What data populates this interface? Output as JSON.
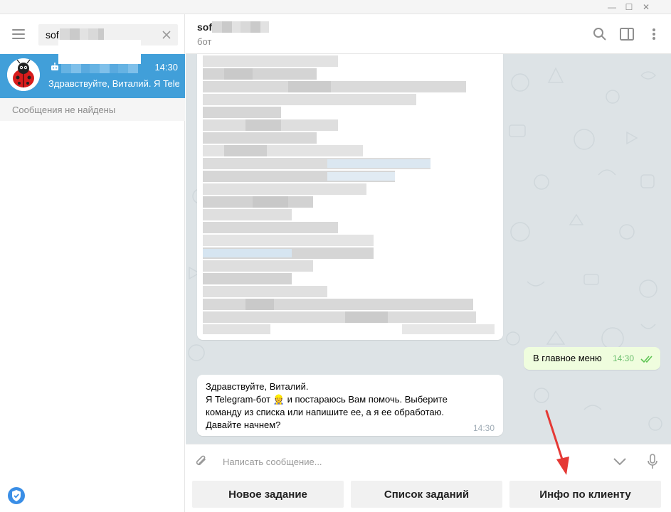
{
  "window": {
    "minimize_glyph": "—",
    "maximize_glyph": "☐",
    "close_glyph": "✕"
  },
  "search": {
    "value": "sof",
    "placeholder": ""
  },
  "chat_list": {
    "items": [
      {
        "time": "14:30",
        "preview": "Здравствуйте, Виталий. Я Telegram-бот"
      }
    ],
    "empty_message": "Сообщения не найдены"
  },
  "header": {
    "name": "sof",
    "status": "бот"
  },
  "messages": {
    "outgoing": {
      "text": "В главное меню",
      "time": "14:30"
    },
    "incoming": {
      "line1": "Здравствуйте, Виталий.",
      "line2_before": "Я Telegram-бот",
      "line2_emoji": "👷",
      "line2_after": "и постараюсь Вам помочь. Выберите",
      "line3": "команду из списка или напишите ее, а я ее обработаю.",
      "line4": "Давайте начнем?",
      "time": "14:30"
    }
  },
  "composer": {
    "placeholder": "Написать сообщение..."
  },
  "keyboard": {
    "buttons": [
      "Новое задание",
      "Список заданий",
      "Инфо по клиенту"
    ]
  },
  "colors": {
    "accent": "#419fd9",
    "chat_background": "#dde3e6",
    "outgoing_bubble": "#effdde",
    "read_check": "#5dc452",
    "annotation_arrow": "#e53935"
  },
  "icons": {
    "menu": "hamburger-menu-icon",
    "search_clear": "close-icon",
    "bot": "bot-icon",
    "search": "search-icon",
    "sidebar": "sidebar-toggle-icon",
    "more": "more-vertical-icon",
    "attach": "paperclip-icon",
    "keyboard_toggle": "chevron-down-icon",
    "mic": "microphone-icon",
    "shield": "shield-check-icon"
  }
}
